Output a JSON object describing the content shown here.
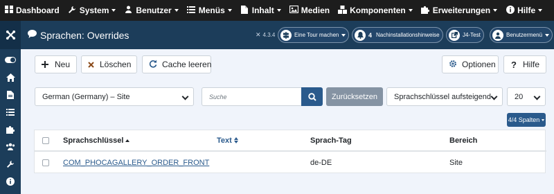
{
  "topbar": {
    "items": [
      {
        "icon": "dashboard-icon",
        "label": "Dashboard",
        "dropdown": false
      },
      {
        "icon": "wrench-icon",
        "label": "System",
        "dropdown": true
      },
      {
        "icon": "users-icon",
        "label": "Benutzer",
        "dropdown": true
      },
      {
        "icon": "list-icon",
        "label": "Menüs",
        "dropdown": true
      },
      {
        "icon": "file-icon",
        "label": "Inhalt",
        "dropdown": true
      },
      {
        "icon": "image-icon",
        "label": "Medien",
        "dropdown": false
      },
      {
        "icon": "cubes-icon",
        "label": "Komponenten",
        "dropdown": true
      },
      {
        "icon": "puzzle-icon",
        "label": "Erweiterungen",
        "dropdown": true
      },
      {
        "icon": "info-icon",
        "label": "Hilfe",
        "dropdown": true
      }
    ]
  },
  "header": {
    "title": "Sprachen: Overrides",
    "version": "4.3.4",
    "tour_label": "Eine Tour machen",
    "notifications_count": "4",
    "notifications_label": "Nachinstallationshinweise",
    "site_label": "J4-Test",
    "user_menu_label": "Benutzermenü"
  },
  "toolbar": {
    "new_label": "Neu",
    "delete_label": "Löschen",
    "clear_cache_label": "Cache leeren",
    "options_label": "Optionen",
    "help_label": "Hilfe"
  },
  "filters": {
    "language_client": "German (Germany) – Site",
    "search_placeholder": "Suche",
    "reset_label": "Zurücksetzen",
    "sort_order": "Sprachschlüssel aufsteigend",
    "list_limit": "20",
    "columns_label": "4/4 Spalten"
  },
  "table": {
    "headers": {
      "key": "Sprachschlüssel",
      "text": "Text",
      "tag": "Sprach-Tag",
      "area": "Bereich"
    },
    "rows": [
      {
        "key": "COM_PHOCAGALLERY_ORDER_FRONT",
        "text": "",
        "tag": "de-DE",
        "area": "Site"
      }
    ]
  },
  "colors": {
    "dark_bar": "#1d1d1d",
    "header": "#1c3d5a",
    "primary": "#2a5a8c",
    "background": "#f0f4fb"
  }
}
